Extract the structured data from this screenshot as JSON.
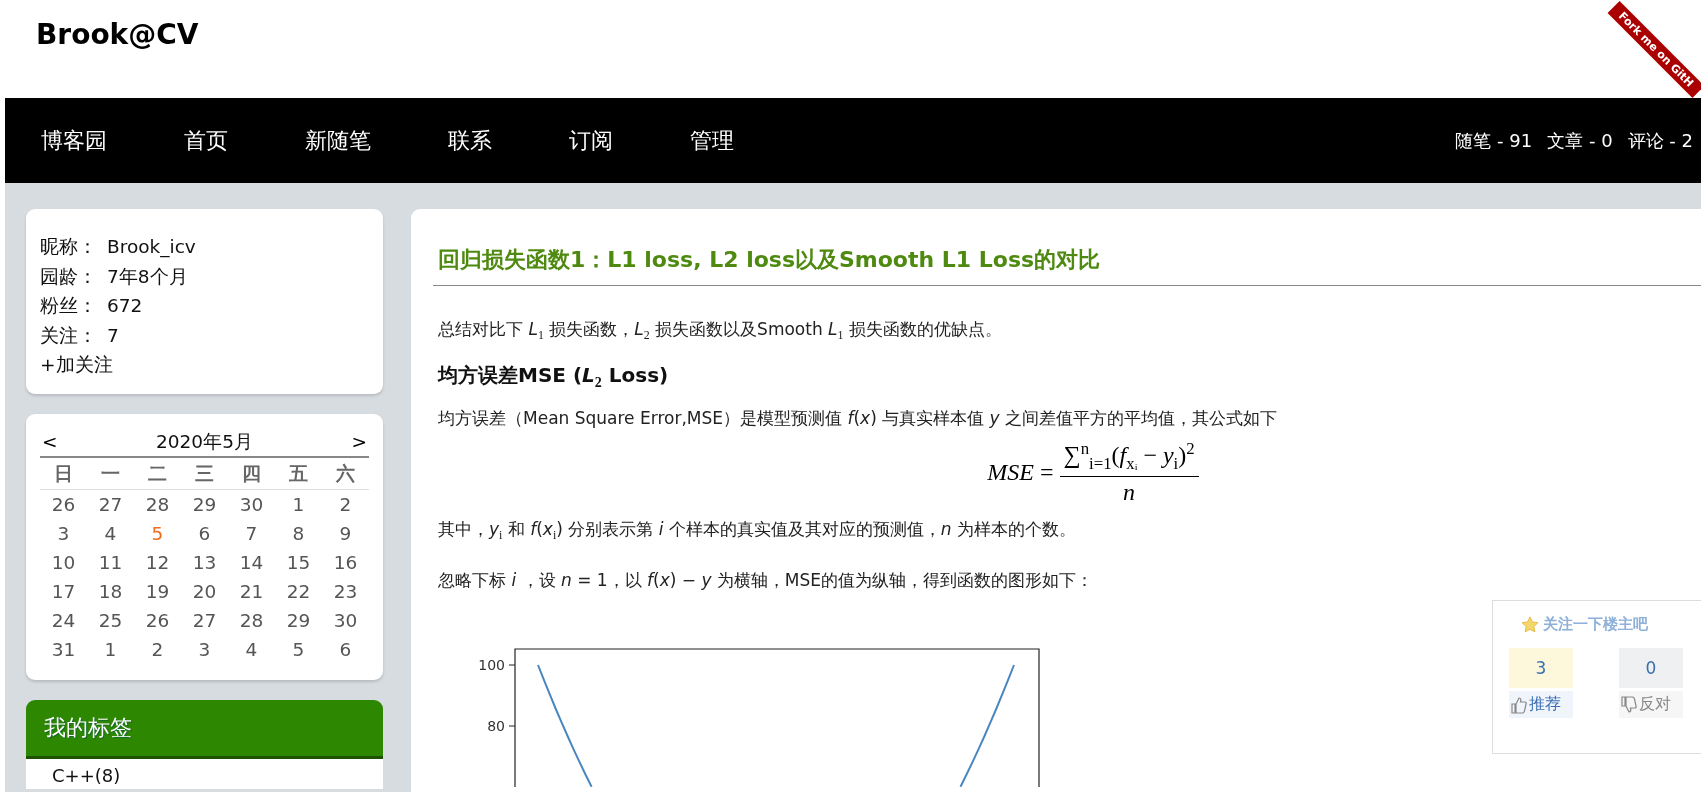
{
  "header": {
    "title": "Brook@CV",
    "ribbon": "Fork me on GitH"
  },
  "nav": {
    "items": [
      {
        "label": "博客园"
      },
      {
        "label": "首页"
      },
      {
        "label": "新随笔"
      },
      {
        "label": "联系"
      },
      {
        "label": "订阅"
      },
      {
        "label": "管理"
      }
    ],
    "stats": [
      "随笔 - 91",
      "文章 - 0",
      "评论 - 2"
    ]
  },
  "profile": {
    "rows": [
      {
        "label": "昵称：",
        "value": "Brook_icv"
      },
      {
        "label": "园龄：",
        "value": "7年8个月"
      },
      {
        "label": "粉丝：",
        "value": "672"
      },
      {
        "label": "关注：",
        "value": "7"
      }
    ],
    "follow": "+加关注"
  },
  "calendar": {
    "prev": "<",
    "title": "2020年5月",
    "next": ">",
    "weekdays": [
      "日",
      "一",
      "二",
      "三",
      "四",
      "五",
      "六"
    ],
    "weeks": [
      [
        {
          "day": "26",
          "today": false
        },
        {
          "day": "27",
          "today": false
        },
        {
          "day": "28",
          "today": false
        },
        {
          "day": "29",
          "today": false
        },
        {
          "day": "30",
          "today": false
        },
        {
          "day": "1",
          "today": false
        },
        {
          "day": "2",
          "today": false
        }
      ],
      [
        {
          "day": "3",
          "today": false
        },
        {
          "day": "4",
          "today": false
        },
        {
          "day": "5",
          "today": true
        },
        {
          "day": "6",
          "today": false
        },
        {
          "day": "7",
          "today": false
        },
        {
          "day": "8",
          "today": false
        },
        {
          "day": "9",
          "today": false
        }
      ],
      [
        {
          "day": "10",
          "today": false
        },
        {
          "day": "11",
          "today": false
        },
        {
          "day": "12",
          "today": false
        },
        {
          "day": "13",
          "today": false
        },
        {
          "day": "14",
          "today": false
        },
        {
          "day": "15",
          "today": false
        },
        {
          "day": "16",
          "today": false
        }
      ],
      [
        {
          "day": "17",
          "today": false
        },
        {
          "day": "18",
          "today": false
        },
        {
          "day": "19",
          "today": false
        },
        {
          "day": "20",
          "today": false
        },
        {
          "day": "21",
          "today": false
        },
        {
          "day": "22",
          "today": false
        },
        {
          "day": "23",
          "today": false
        }
      ],
      [
        {
          "day": "24",
          "today": false
        },
        {
          "day": "25",
          "today": false
        },
        {
          "day": "26",
          "today": false
        },
        {
          "day": "27",
          "today": false
        },
        {
          "day": "28",
          "today": false
        },
        {
          "day": "29",
          "today": false
        },
        {
          "day": "30",
          "today": false
        }
      ],
      [
        {
          "day": "31",
          "today": false
        },
        {
          "day": "1",
          "today": false
        },
        {
          "day": "2",
          "today": false
        },
        {
          "day": "3",
          "today": false
        },
        {
          "day": "4",
          "today": false
        },
        {
          "day": "5",
          "today": false
        },
        {
          "day": "6",
          "today": false
        }
      ]
    ]
  },
  "tags": {
    "title": "我的标签",
    "items": [
      "C++(8)"
    ]
  },
  "article": {
    "title": "回归损失函数1：L1 loss, L2 loss以及Smooth L1 Loss的对比",
    "blocks": [
      {
        "kind": "para",
        "text": "总结对比下 *L*$_{1}$ 损失函数，*L*$_{2}$ 损失函数以及Smooth *L*$_{1}$ 损失函数的优缺点。"
      },
      {
        "kind": "heading",
        "text": "均方误差MSE (*L*$_{2}$ Loss)"
      },
      {
        "kind": "para",
        "text": "均方误差（Mean Square Error,MSE）是模型预测值 *f*(*x*) 与真实样本值 *y* 之间差值平方的平均值，其公式如下"
      },
      {
        "kind": "formula",
        "lhs": "*MSE* =",
        "numerator": "∑$^{n}$$_{i=1}$(*f*$_{xᵢ}$ − *y*$_{i}$)$^{2}$",
        "denominator": "*n*"
      },
      {
        "kind": "para",
        "text": "其中，*y*$_{i}$ 和 *f*(*x*$_{i}$) 分别表示第 *i* 个样本的真实值及其对应的预测值，*n* 为样本的个数。"
      },
      {
        "kind": "para",
        "text": "忽略下标 *i* ，设 *n* = 1，以 *f*(*x*) − *y* 为横轴，MSE的值为纵轴，得到函数的图形如下："
      },
      {
        "kind": "plot",
        "y_tick_labels": [
          "100",
          "80"
        ]
      }
    ]
  },
  "vote": {
    "title": "关注一下楼主吧",
    "up_count": "3",
    "up_label": "推荐",
    "down_count": "0",
    "down_label": "反对"
  }
}
